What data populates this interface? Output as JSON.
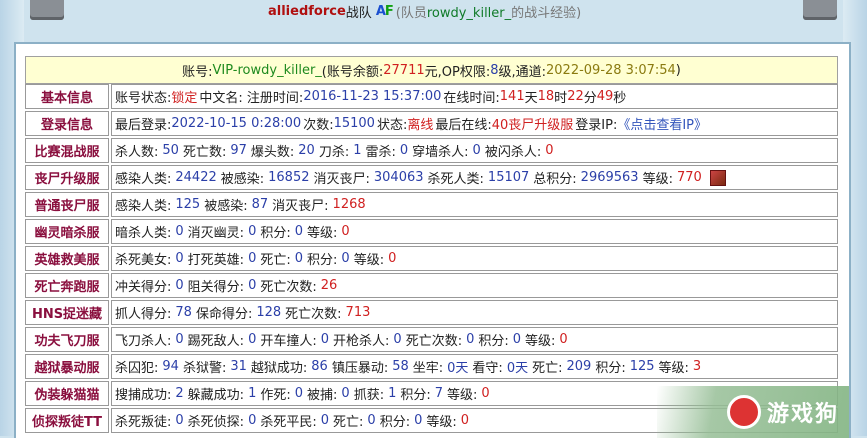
{
  "title": {
    "team": "alliedforce",
    "suffix": "战队",
    "logo_a": "A",
    "logo_b": "F",
    "sub_prefix": "(队员",
    "username": "rowdy_killer_",
    "sub_suffix": "的战斗经验)"
  },
  "account": {
    "label_account": "账号:",
    "account_id": "VIP-rowdy_killer_",
    "label_balance": "(账号余额:",
    "balance": "27711",
    "label_op": "元,OP权限:",
    "op_level": "8",
    "label_channel": "级,通道:",
    "channel_time": "2022-09-28 3:07:54",
    "close": ")"
  },
  "rows": [
    {
      "category": "基本信息",
      "parts": {
        "l1": "账号状态:",
        "v1": "锁定",
        "l2": "中文名:  注册时间:",
        "v2": "2016-11-23 15:37:00",
        "l3": "在线时间:",
        "v3": "141",
        "l4": "天",
        "v4": "18",
        "l5": "时",
        "v5": "22",
        "l6": "分",
        "v6": "49",
        "l7": "秒"
      }
    },
    {
      "category": "登录信息",
      "parts": {
        "l1": "最后登录:",
        "v1": "2022-10-15 0:28:00",
        "l2": "次数:",
        "v2": "15100",
        "l3": "状态:",
        "v3": "离线",
        "l4": "最后在线:",
        "v4": "40丧尸升级服",
        "l5": "登录IP:",
        "v5": "《点击查看IP》"
      }
    },
    {
      "category": "比赛混战服",
      "text": "杀人数:|50|死亡数:|97|爆头数:|20|刀杀:|1|雷杀:|0|穿墙杀人:|0|被闪杀人:|0"
    },
    {
      "category": "丧尸升级服",
      "text": "感染人类:|24422|被感染:|16852|消灭丧尸:|304063|杀死人类:|15107|总积分:|2969563|等级:|770",
      "rank_icon": "rank-badge-icon"
    },
    {
      "category": "普通丧尸服",
      "text": "感染人类:|125|被感染:|87|消灭丧尸:|1268"
    },
    {
      "category": "幽灵暗杀服",
      "text": "暗杀人类:|0|消灭幽灵:|0|积分:|0|等级:|0"
    },
    {
      "category": "英雄救美服",
      "text": "杀死美女:|0|打死英雄:|0|死亡:|0|积分:|0|等级:|0"
    },
    {
      "category": "死亡奔跑服",
      "text": "冲关得分:|0|阻关得分:|0|死亡次数:|26"
    },
    {
      "category": "HNS捉迷藏",
      "text": "抓人得分:|78|保命得分:|128|死亡次数:|713"
    },
    {
      "category": "功夫飞刀服",
      "text": "飞刀杀人:|0|踢死敌人:|0|开车撞人:|0|开枪杀人:|0|死亡次数:|0|积分:|0|等级:|0"
    },
    {
      "category": "越狱暴动服",
      "text": "杀囚犯:|94|杀狱警:|31|越狱成功:|86|镇压暴动:|58|坐牢:|0天|看守:|0天|死亡:|209|积分:|125|等级:|3"
    },
    {
      "category": "伪装躲猫猫",
      "text": "搜捕成功:|2|躲藏成功:|1|作死:|0|被捕:|0|抓获:|1|积分:|7|等级:|0"
    },
    {
      "category": "侦探叛徒TT",
      "text": "杀死叛徒:|0|杀死侦探:|0|杀死平民:|0|死亡:|0|积分:|0|等级:|0"
    }
  ],
  "watermark": {
    "text": "游戏狗"
  },
  "colors": {
    "value_blue": "#2b3fa8",
    "last_value_red": "#d02020",
    "category": "#8a0f3e",
    "account_bg": "#ffffd2"
  }
}
